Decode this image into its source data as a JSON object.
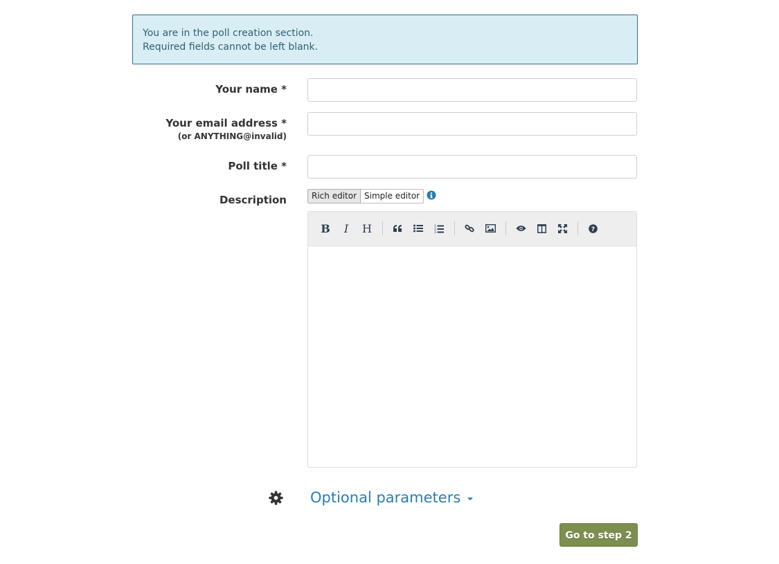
{
  "alert": {
    "line1": "You are in the poll creation section.",
    "line2": "Required fields cannot be left blank."
  },
  "form": {
    "name_label": "Your name *",
    "email_label": "Your email address *",
    "email_hint": "(or ANYTHING@invalid)",
    "title_label": "Poll title *",
    "description_label": "Description",
    "name_value": "",
    "email_value": "",
    "title_value": ""
  },
  "editor": {
    "modes": [
      "Rich editor",
      "Simple editor"
    ],
    "active_mode": "Rich editor",
    "toolbar": [
      "bold",
      "italic",
      "heading",
      "quote",
      "unordered-list",
      "ordered-list",
      "link",
      "image",
      "preview",
      "side-by-side",
      "fullscreen",
      "guide"
    ],
    "content": ""
  },
  "optional": {
    "label": "Optional parameters"
  },
  "actions": {
    "next_label": "Go to step 2"
  },
  "colors": {
    "accent": "#2a7cb0",
    "alert_bg": "#d9eef4",
    "primary_button": "#7c8f4e"
  }
}
